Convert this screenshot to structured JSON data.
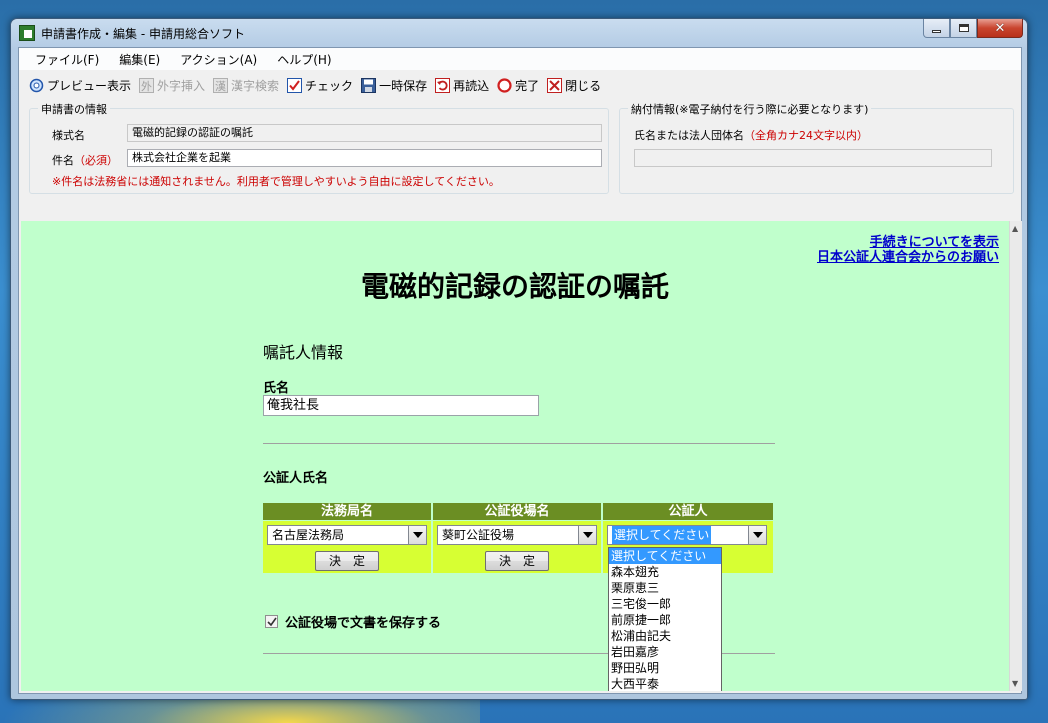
{
  "window": {
    "title": "申請書作成・編集 - 申請用総合ソフト"
  },
  "menubar": [
    "ファイル(F)",
    "編集(E)",
    "アクション(A)",
    "ヘルプ(H)"
  ],
  "toolbar": [
    {
      "label": "プレビュー表示",
      "icon": "preview-icon",
      "enabled": true
    },
    {
      "label": "外字挿入",
      "icon": "gaiji-icon",
      "enabled": false
    },
    {
      "label": "漢字検索",
      "icon": "kanji-search-icon",
      "enabled": false
    },
    {
      "label": "チェック",
      "icon": "check-icon",
      "enabled": true
    },
    {
      "label": "一時保存",
      "icon": "save-icon",
      "enabled": true
    },
    {
      "label": "再読込",
      "icon": "reload-icon",
      "enabled": true
    },
    {
      "label": "完了",
      "icon": "complete-icon",
      "enabled": true
    },
    {
      "label": "閉じる",
      "icon": "close-icon",
      "enabled": true
    }
  ],
  "app_info": {
    "legend": "申請書の情報",
    "form_name_label": "様式名",
    "form_name_value": "電磁的記録の認証の嘱託",
    "subject_label": "件名",
    "subject_required": "（必須）",
    "subject_value": "株式会社企業を起業",
    "note": "※件名は法務省には通知されません。利用者で管理しやすいよう自由に設定してください。"
  },
  "payment_info": {
    "legend": "納付情報(※電子納付を行う際に必要となります)",
    "name_label": "氏名または法人団体名",
    "name_hint": "（全角カナ24文字以内）",
    "name_value": ""
  },
  "links": {
    "procedure": "手続きについてを表示",
    "notary_assoc": "日本公証人連合会からのお願い"
  },
  "form": {
    "title": "電磁的記録の認証の嘱託",
    "requester_section": "嘱託人情報",
    "name_label": "氏名",
    "name_value": "俺我社長",
    "notary_section": "公証人氏名",
    "columns": [
      "法務局名",
      "公証役場名",
      "公証人"
    ],
    "bureau_value": "名古屋法務局",
    "office_value": "葵町公証役場",
    "notary_value": "選択してください",
    "decide_label": "決　定",
    "notary_options": [
      "選択してください",
      "森本翅充",
      "栗原恵三",
      "三宅俊一郎",
      "前原捷一郎",
      "松浦由記夫",
      "岩田嘉彦",
      "野田弘明",
      "大西平泰"
    ],
    "save_doc_label": "公証役場で文書を保存する",
    "save_doc_checked": true
  },
  "colors": {
    "content_bg": "#c0ffcc",
    "table_header": "#6b8e23",
    "table_cell": "#d7ff33",
    "link": "#0000cc",
    "required": "#cc0000"
  }
}
